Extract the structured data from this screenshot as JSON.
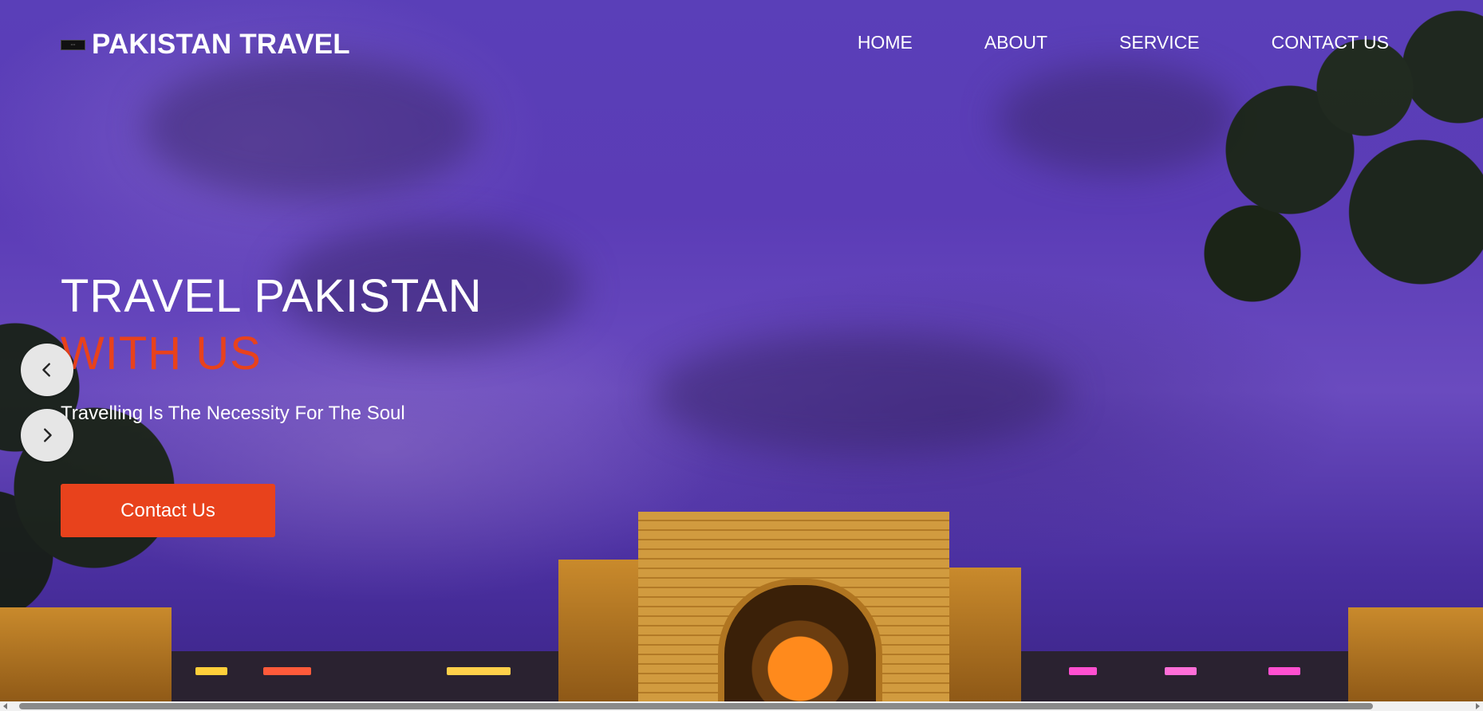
{
  "brand": {
    "name": "PAKISTAN TRAVEL",
    "logo_icon": "brand-logo-icon"
  },
  "nav": {
    "items": [
      {
        "label": "HOME"
      },
      {
        "label": "ABOUT"
      },
      {
        "label": "SERVICE"
      },
      {
        "label": "CONTACT US"
      }
    ]
  },
  "hero": {
    "title": "TRAVEL PAKISTAN",
    "highlight": "WITH US",
    "subtitle": "Travelling Is The Necessity For The Soul",
    "cta_label": "Contact Us"
  },
  "slider": {
    "prev_icon": "chevron-left-icon",
    "next_icon": "chevron-right-icon"
  },
  "colors": {
    "accent": "#e8421c",
    "text": "#ffffff",
    "sky": "#5b3cb6"
  }
}
